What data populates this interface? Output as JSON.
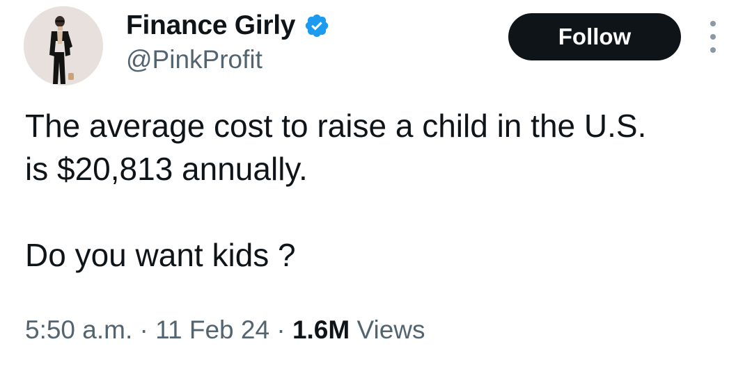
{
  "author": {
    "display_name": "Finance Girly",
    "handle": "@PinkProfit",
    "verified": true
  },
  "actions": {
    "follow_label": "Follow",
    "more_icon": "more-vertical-icon"
  },
  "tweet": {
    "line1": "The average cost to raise a child in the U.S.",
    "line2": "is $20,813 annually.",
    "line3": "Do you want kids ?"
  },
  "meta": {
    "time": "5:50 a.m.",
    "separator": "·",
    "date": "11 Feb 24",
    "views_count": "1.6M",
    "views_label": "Views"
  },
  "colors": {
    "primary_text": "#0f1419",
    "secondary_text": "#536471",
    "follow_bg": "#0f1419",
    "verified_badge": "#1d9bf0"
  }
}
